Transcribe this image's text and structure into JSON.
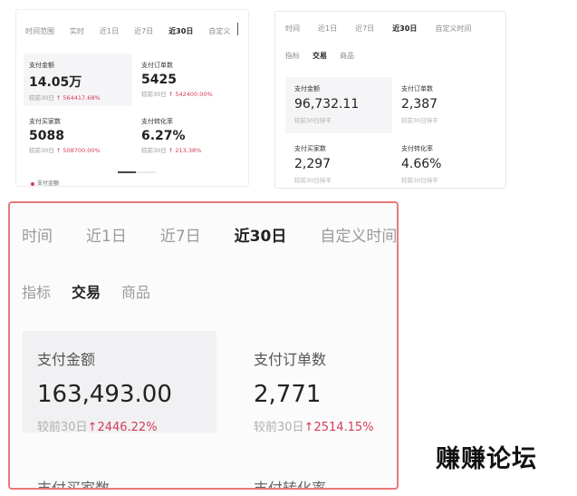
{
  "panel1": {
    "tabs": [
      "时间范围",
      "实时",
      "近1日",
      "近7日",
      "近30日",
      "自定义"
    ],
    "active_tab": "近30日",
    "cards": [
      {
        "label": "支付金额",
        "value": "14.05万",
        "compare": "较前30日",
        "change": "↑ 564417.68%"
      },
      {
        "label": "支付订单数",
        "value": "5425",
        "compare": "较前30日",
        "change": "↑ 542400.00%"
      },
      {
        "label": "支付买家数",
        "value": "5088",
        "compare": "较前30日",
        "change": "↑ 508700.00%"
      },
      {
        "label": "支付转化率",
        "value": "6.27%",
        "compare": "较前30日",
        "change": "↑ 213.38%"
      }
    ],
    "legend": "支付金额"
  },
  "panel2": {
    "tabs": [
      "时间",
      "近1日",
      "近7日",
      "近30日",
      "自定义时间"
    ],
    "active_tab": "近30日",
    "subtabs": [
      "指标",
      "交易",
      "商品"
    ],
    "active_subtab": "交易",
    "cards": [
      {
        "label": "支付金额",
        "value": "96,732.11",
        "compare": "较前30日持平"
      },
      {
        "label": "支付订单数",
        "value": "2,387",
        "compare": "较前30日持平"
      },
      {
        "label": "支付买家数",
        "value": "2,297",
        "compare": "较前30日持平"
      },
      {
        "label": "支付转化率",
        "value": "4.66%",
        "compare": "较前30日持平"
      }
    ]
  },
  "panel3": {
    "tabs": [
      "时间",
      "近1日",
      "近7日",
      "近30日",
      "自定义时间"
    ],
    "active_tab": "近30日",
    "subtabs": [
      "指标",
      "交易",
      "商品"
    ],
    "active_subtab": "交易",
    "cards": [
      {
        "label": "支付金额",
        "value": "163,493.00",
        "compare": "较前30日",
        "change": "↑2446.22%"
      },
      {
        "label": "支付订单数",
        "value": "2,771",
        "compare": "较前30日",
        "change": "↑2514.15%"
      }
    ],
    "cut_labels": [
      "支付买家数",
      "支付转化率"
    ]
  },
  "watermark": "赚赚论坛",
  "colors": {
    "accent": "#d23c5a",
    "highlight_border": "#e97878"
  }
}
